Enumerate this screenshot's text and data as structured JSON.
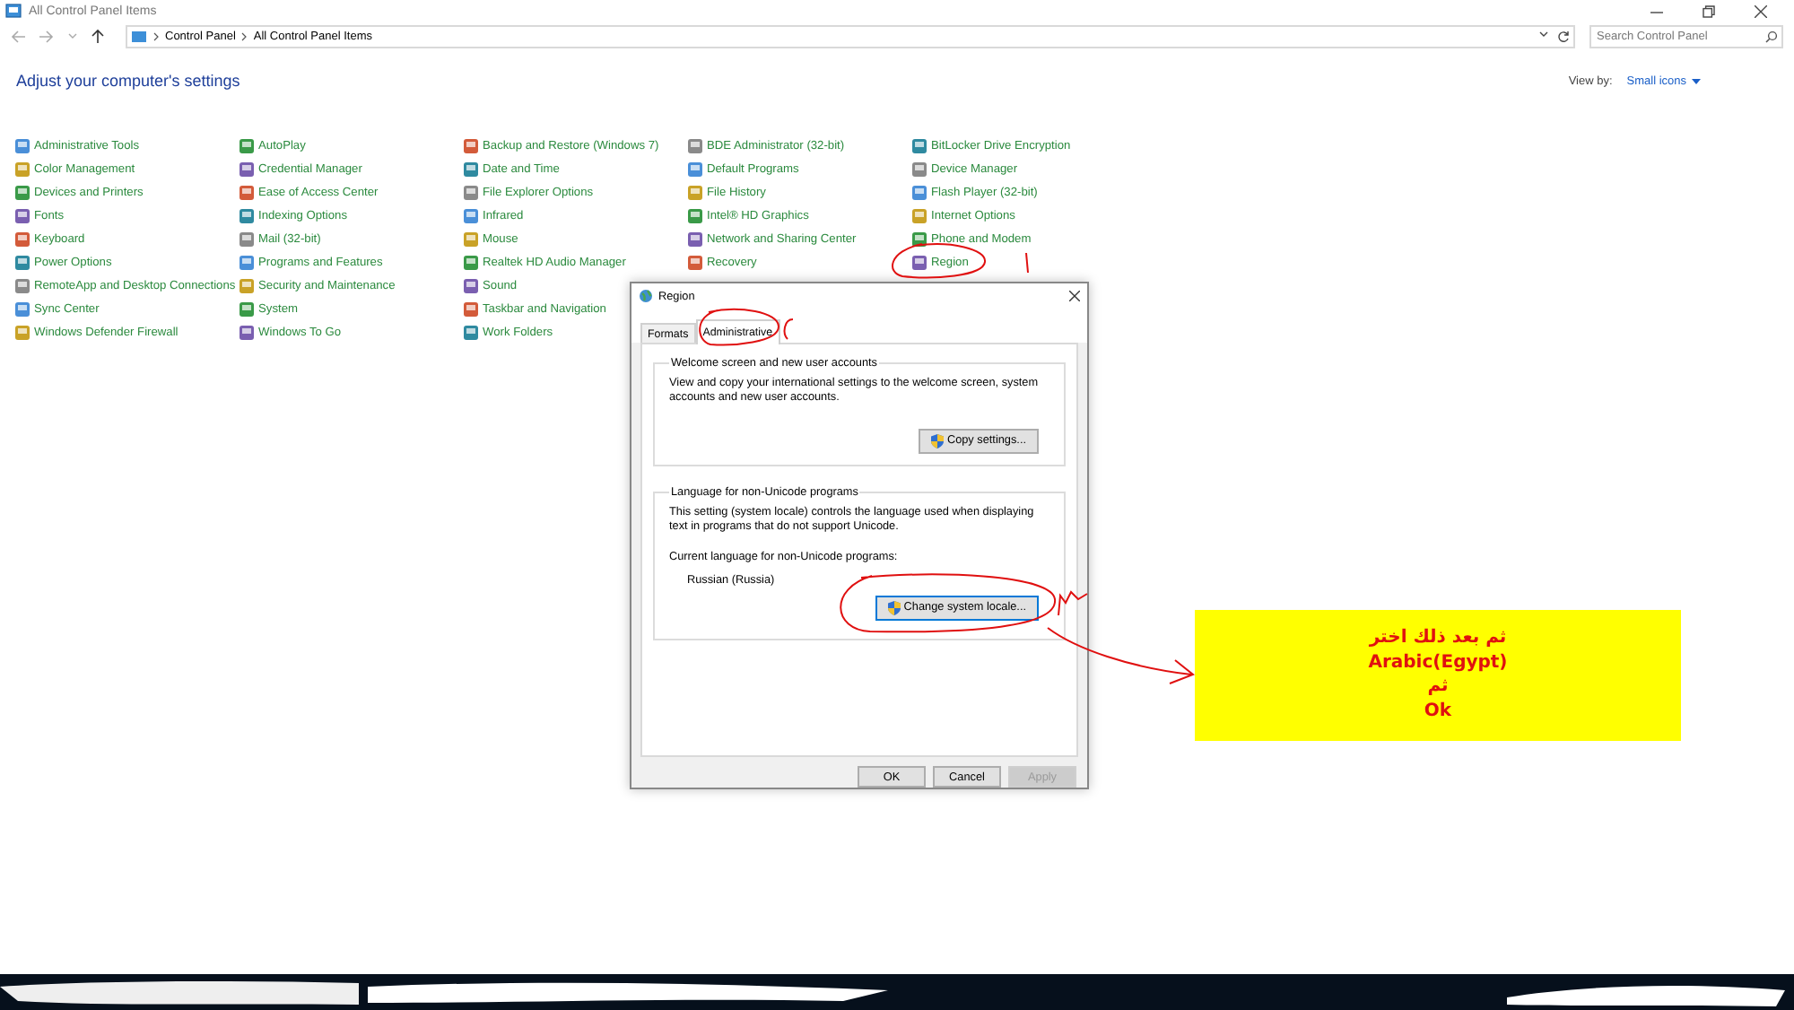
{
  "window": {
    "title": "All Control Panel Items"
  },
  "address_bar": {
    "path": [
      "Control Panel",
      "All Control Panel Items"
    ]
  },
  "search": {
    "placeholder": "Search Control Panel"
  },
  "heading": "Adjust your computer's settings",
  "view_by": {
    "label": "View by:",
    "value": "Small icons"
  },
  "items": [
    [
      "Administrative Tools",
      "Color Management",
      "Devices and Printers",
      "Fonts",
      "Keyboard",
      "Power Options",
      "RemoteApp and Desktop Connections",
      "Sync Center",
      "Windows Defender Firewall"
    ],
    [
      "AutoPlay",
      "Credential Manager",
      "Ease of Access Center",
      "Indexing Options",
      "Mail (32-bit)",
      "Programs and Features",
      "Security and Maintenance",
      "System",
      "Windows To Go"
    ],
    [
      "Backup and Restore (Windows 7)",
      "Date and Time",
      "File Explorer Options",
      "Infrared",
      "Mouse",
      "Realtek HD Audio Manager",
      "Sound",
      "Taskbar and Navigation",
      "Work Folders"
    ],
    [
      "BDE Administrator (32-bit)",
      "Default Programs",
      "File History",
      "Intel® HD Graphics",
      "Network and Sharing Center",
      "Recovery"
    ],
    [
      "BitLocker Drive Encryption",
      "Device Manager",
      "Flash Player (32-bit)",
      "Internet Options",
      "Phone and Modem",
      "Region"
    ]
  ],
  "dialog": {
    "title": "Region",
    "tabs": [
      {
        "label": "Formats",
        "selected": false
      },
      {
        "label": "Administrative",
        "selected": true
      }
    ],
    "groups": [
      {
        "title": "Welcome screen and new user accounts",
        "text": "View and copy your international settings to the welcome screen, system accounts and new user accounts.",
        "button": "Copy settings..."
      },
      {
        "title": "Language for non-Unicode programs",
        "text": "This setting (system locale) controls the language used when displaying text in programs that do not support Unicode.",
        "current_label": "Current language for non-Unicode programs:",
        "current_value": "Russian (Russia)",
        "button": "Change system locale..."
      }
    ],
    "buttons": [
      {
        "label": "OK",
        "disabled": false
      },
      {
        "label": "Cancel",
        "disabled": false
      },
      {
        "label": "Apply",
        "disabled": true
      }
    ]
  },
  "note": {
    "lines": [
      "ثم بعد ذلك اختر",
      "Arabic(Egypt)",
      "ثم",
      "Ok"
    ]
  }
}
